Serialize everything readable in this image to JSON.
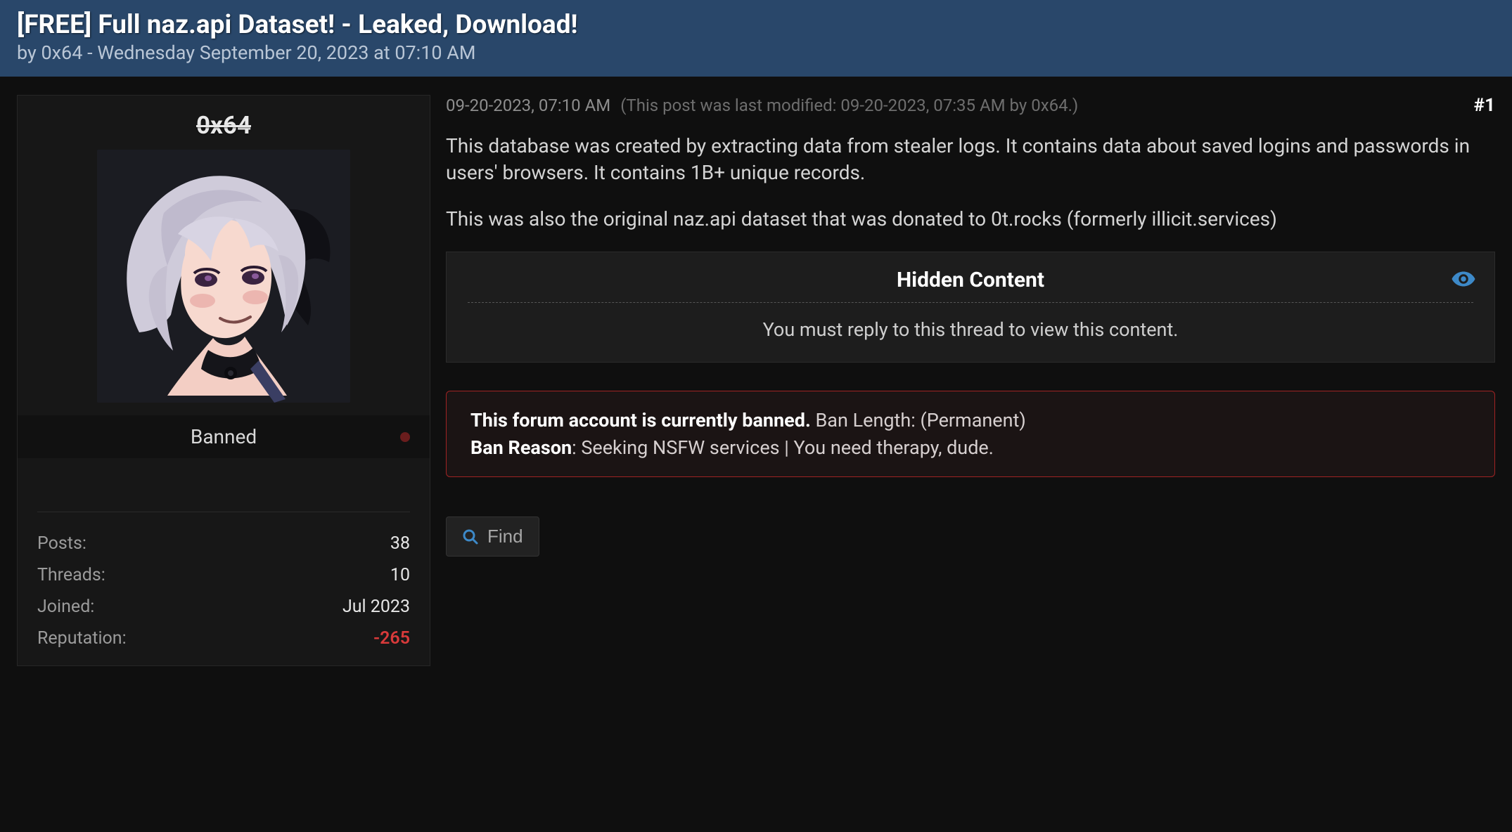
{
  "thread": {
    "title": "[FREE] Full naz.api Dataset! - Leaked, Download!",
    "byline": "by 0x64 - Wednesday September 20, 2023 at 07:10 AM"
  },
  "author": {
    "name": "0x64",
    "status": "Banned",
    "stats": {
      "posts_label": "Posts:",
      "posts_value": "38",
      "threads_label": "Threads:",
      "threads_value": "10",
      "joined_label": "Joined:",
      "joined_value": "Jul 2023",
      "reputation_label": "Reputation:",
      "reputation_value": "-265"
    }
  },
  "post": {
    "timestamp": "09-20-2023, 07:10 AM",
    "modified": "(This post was last modified: 09-20-2023, 07:35 AM by 0x64.)",
    "number": "#1",
    "para1": "This database was created by extracting data from stealer logs. It contains data about saved logins and passwords in users' browsers. It contains 1B+ unique records.",
    "para2": "This was also the original naz.api dataset that was donated to 0t.rocks (formerly illicit.services)"
  },
  "hidden": {
    "title": "Hidden Content",
    "message": "You must reply to this thread to view this content."
  },
  "ban": {
    "line1_strong": "This forum account is currently banned.",
    "line1_rest": " Ban Length: (Permanent)",
    "line2_label": "Ban Reason",
    "line2_rest": ": Seeking NSFW services | You need therapy, dude."
  },
  "actions": {
    "find": "Find"
  }
}
